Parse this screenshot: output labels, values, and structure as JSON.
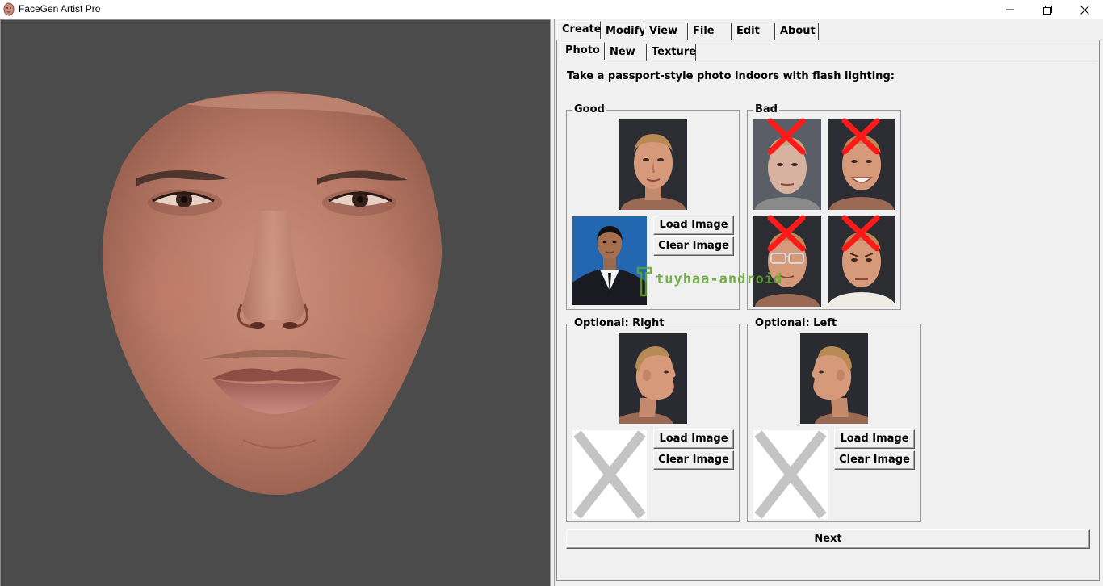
{
  "window": {
    "title": "FaceGen Artist Pro",
    "minimize_glyph": "minimize-icon",
    "restore_glyph": "restore-icon",
    "close_glyph": "close-icon"
  },
  "main_tabs": [
    {
      "label": "Create",
      "active": true
    },
    {
      "label": "Modify",
      "active": false
    },
    {
      "label": "View",
      "active": false
    },
    {
      "label": "File",
      "active": false
    },
    {
      "label": "Edit",
      "active": false
    },
    {
      "label": "About",
      "active": false
    }
  ],
  "sub_tabs": [
    {
      "label": "Photo",
      "active": true
    },
    {
      "label": "New",
      "active": false
    },
    {
      "label": "Texture",
      "active": false
    }
  ],
  "instruction": "Take a passport-style photo indoors with flash lighting:",
  "groups": {
    "good": {
      "label": "Good",
      "load_label": "Load Image",
      "clear_label": "Clear Image"
    },
    "bad": {
      "label": "Bad"
    },
    "right": {
      "label": "Optional: Right",
      "load_label": "Load Image",
      "clear_label": "Clear Image"
    },
    "left": {
      "label": "Optional: Left",
      "load_label": "Load Image",
      "clear_label": "Clear Image"
    }
  },
  "watermark": "tuyhaa-android",
  "next_label": "Next",
  "colors": {
    "viewport_bg": "#4b4b4b",
    "panel_bg": "#f0f0f0",
    "bad_mark": "#ff1a1a",
    "placeholder_x": "#c4c4c4",
    "watermark": "#5fa62a"
  }
}
